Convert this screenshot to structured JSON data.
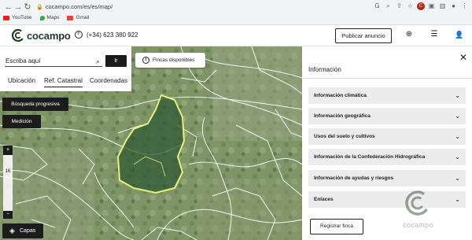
{
  "browser": {
    "url": "cocampo.com/es/es/map/",
    "bookmarks": [
      {
        "label": "YouTube",
        "color": "#e62117"
      },
      {
        "label": "Maps",
        "color": "#34a853"
      },
      {
        "label": "Gmail",
        "color": "#ea4335"
      }
    ],
    "profile_initial": "C"
  },
  "header": {
    "logo_text": "cocampo",
    "phone": "(+34) 623 380 922",
    "publish_label": "Publicar anuncio",
    "brand_color": "#1f3b26"
  },
  "search": {
    "placeholder": "Escriba aquí",
    "go_label": "Ir",
    "tabs": [
      "Ubicación",
      "Ref. Catastral",
      "Coordenadas"
    ],
    "active_tab": "Ref. Catastral"
  },
  "map": {
    "fincas_label": "Fincas disponibles",
    "progressive_search_label": "Búsqueda progresiva",
    "measure_label": "Medición",
    "zoom_in": "+",
    "zoom_level": "16",
    "zoom_out": "−",
    "layers_label": "Capas",
    "highlight_color": "#e6f07a"
  },
  "info_panel": {
    "tab_label": "Información",
    "close_icon": "close-icon",
    "sections": [
      "Información climática",
      "Información geográfica",
      "Usos del suelo y cultivos",
      "Información de la Confederación Hidrográfica",
      "Información de ayudas y riesgos",
      "Enlaces"
    ],
    "register_label": "Registrar finca",
    "watermark_text": "cocampo"
  }
}
